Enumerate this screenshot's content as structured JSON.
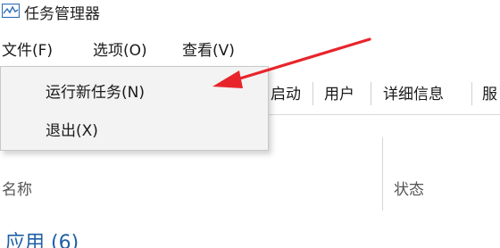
{
  "window": {
    "title": "任务管理器",
    "icon": "task-manager-icon"
  },
  "menubar": {
    "file": "文件(F)",
    "options": "选项(O)",
    "view": "查看(V)"
  },
  "dropdown": {
    "run_new_task": "运行新任务(N)",
    "exit": "退出(X)"
  },
  "tabs": {
    "startup_partial": "启动",
    "users": "用户",
    "details": "详细信息",
    "services_partial": "服"
  },
  "columns": {
    "name": "名称",
    "status": "状态"
  },
  "group": {
    "apps": "应用 (6)"
  },
  "colors": {
    "accent_blue": "#1f5fa6",
    "annotation_red": "#e8242b"
  }
}
